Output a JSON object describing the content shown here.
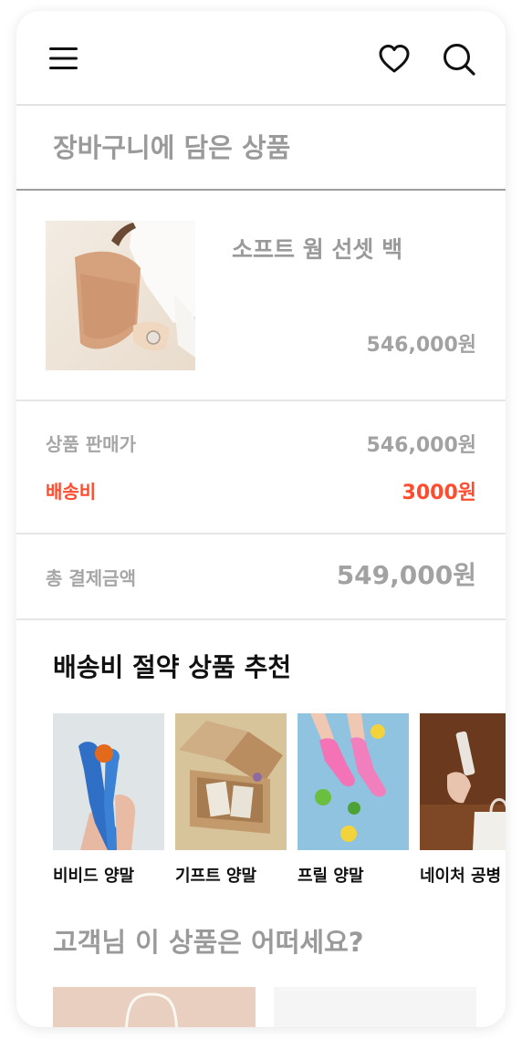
{
  "header": {
    "menu_icon": "hamburger-menu-icon",
    "wishlist_icon": "heart-icon",
    "search_icon": "search-icon"
  },
  "cart": {
    "title": "장바구니에 담은 상품",
    "item": {
      "name": "소프트 웜 선셋 백",
      "price": "546,000원"
    }
  },
  "summary": {
    "subtotal_label": "상품 판매가",
    "subtotal_value": "546,000원",
    "shipping_label": "배송비",
    "shipping_value": "3000원",
    "total_label": "총 결제금액",
    "total_value": "549,000원",
    "accent_color": "#ff4b2e"
  },
  "recommend": {
    "title": "배송비 절약 상품 추천",
    "items": [
      {
        "label": "비비드 양말"
      },
      {
        "label": "기프트 양말"
      },
      {
        "label": "프릴 양말"
      },
      {
        "label": "네이처 공병"
      }
    ]
  },
  "suggest": {
    "title": "고객님 이 상품은 어떠세요?"
  }
}
